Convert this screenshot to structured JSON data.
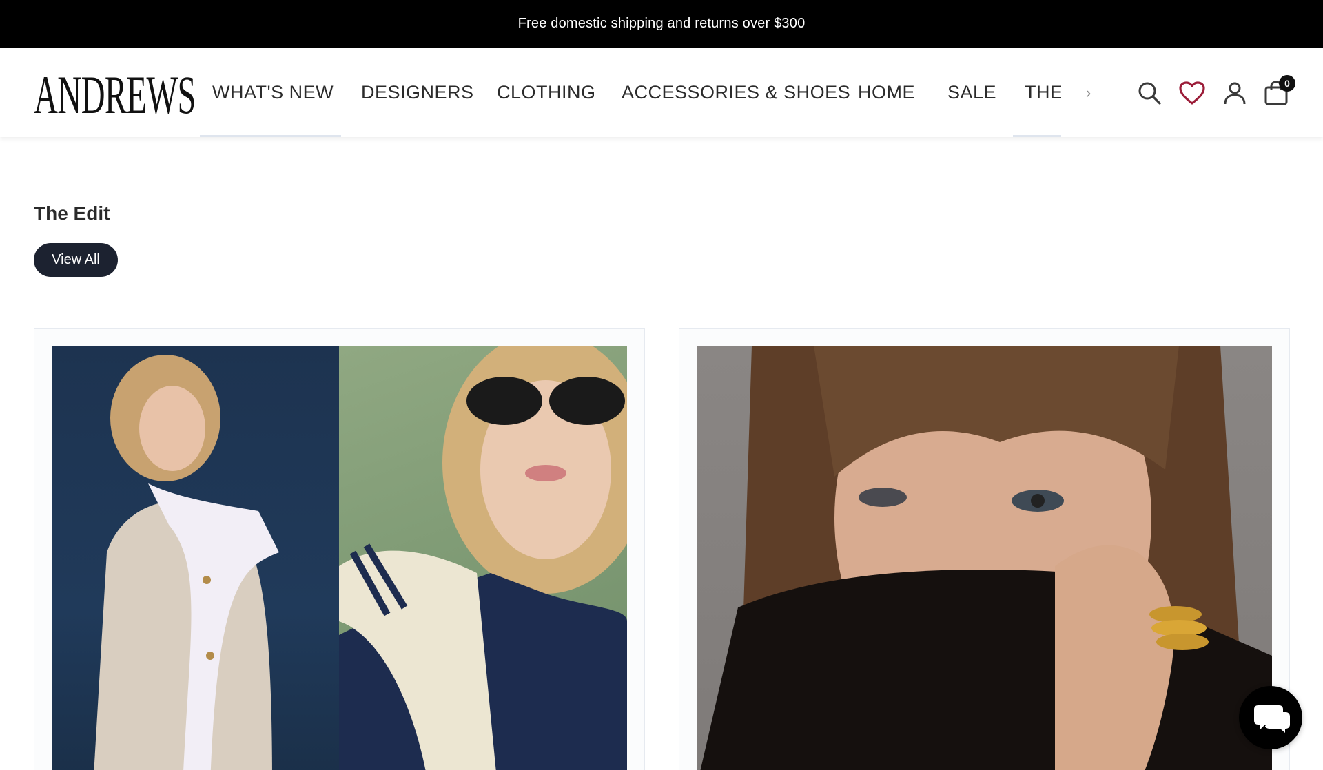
{
  "promo": {
    "text": "Free domestic shipping and returns over $300"
  },
  "header": {
    "logo": "ANDREWS",
    "nav": [
      {
        "label": "WHAT'S NEW"
      },
      {
        "label": "DESIGNERS"
      },
      {
        "label": "CLOTHING"
      },
      {
        "label": "ACCESSORIES & SHOES"
      },
      {
        "label": "HOME"
      },
      {
        "label": "SALE"
      },
      {
        "label": "THE E"
      }
    ],
    "icons": [
      "search-icon",
      "heart-icon",
      "account-icon",
      "shopping-bag-icon"
    ],
    "cart_count": "0",
    "wishlist_color": "#9b1c38"
  },
  "main": {
    "section_title": "The Edit",
    "view_all_label": "View All"
  },
  "colors": {
    "navy_button": "#1c2230",
    "promo_bg": "#000000"
  }
}
